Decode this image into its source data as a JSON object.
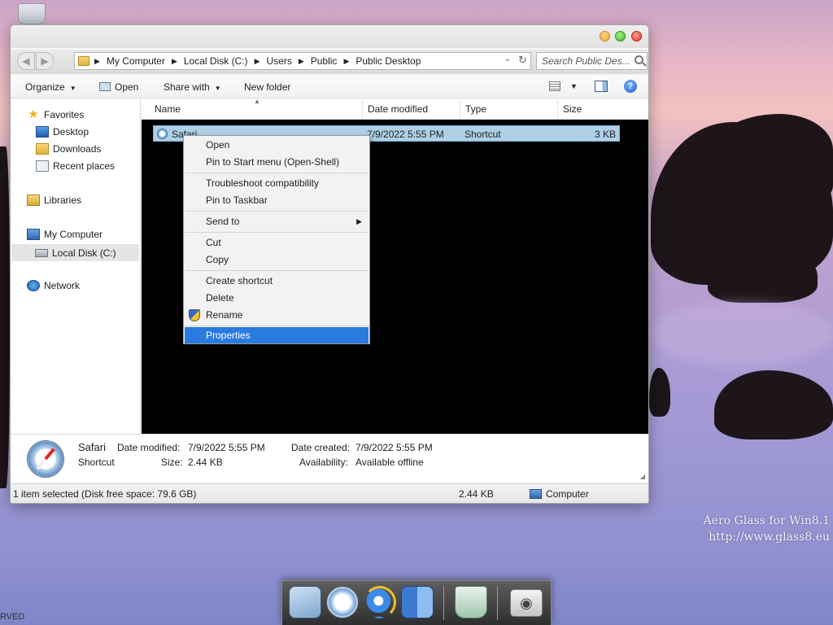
{
  "desktop": {
    "edge_text": "RVED",
    "watermark_line1": "Aero Glass for Win8.1",
    "watermark_line2": "http://www.glass8.eu"
  },
  "window": {
    "breadcrumb": [
      "My Computer",
      "Local Disk (C:)",
      "Users",
      "Public",
      "Public Desktop"
    ],
    "search_placeholder": "Search Public Des...",
    "toolbar": {
      "organize": "Organize",
      "open": "Open",
      "share_with": "Share with",
      "new_folder": "New folder"
    },
    "nav": {
      "favorites": "Favorites",
      "desktop": "Desktop",
      "downloads": "Downloads",
      "recent_places": "Recent places",
      "libraries": "Libraries",
      "my_computer": "My Computer",
      "local_disk": "Local Disk (C:)",
      "network": "Network"
    },
    "columns": {
      "name": "Name",
      "date_modified": "Date modified",
      "type": "Type",
      "size": "Size"
    },
    "file": {
      "name": "Safari",
      "date_modified": "7/9/2022 5:55 PM",
      "type": "Shortcut",
      "size": "3 KB"
    },
    "details": {
      "name": "Safari",
      "kind": "Shortcut",
      "date_modified_label": "Date modified:",
      "date_modified": "7/9/2022 5:55 PM",
      "size_label": "Size:",
      "size": "2.44 KB",
      "date_created_label": "Date created:",
      "date_created": "7/9/2022 5:55 PM",
      "availability_label": "Availability:",
      "availability": "Available offline"
    },
    "status": {
      "selection": "1 item selected (Disk free space: 79.6 GB)",
      "size": "2.44 KB",
      "location": "Computer"
    }
  },
  "context_menu": {
    "open": "Open",
    "pin_start": "Pin to Start menu (Open-Shell)",
    "troubleshoot": "Troubleshoot compatibility",
    "pin_taskbar": "Pin to Taskbar",
    "send_to": "Send to",
    "cut": "Cut",
    "copy": "Copy",
    "create_shortcut": "Create shortcut",
    "delete": "Delete",
    "rename": "Rename",
    "properties": "Properties"
  },
  "dock": {
    "apps": [
      "mail-icon",
      "safari-icon",
      "internet-explorer-icon",
      "finder-icon",
      "recycle-bin-icon",
      "apple-icon"
    ]
  },
  "colors": {
    "selection_highlight": "#add0e6",
    "menu_highlight": "#2a7be0"
  }
}
